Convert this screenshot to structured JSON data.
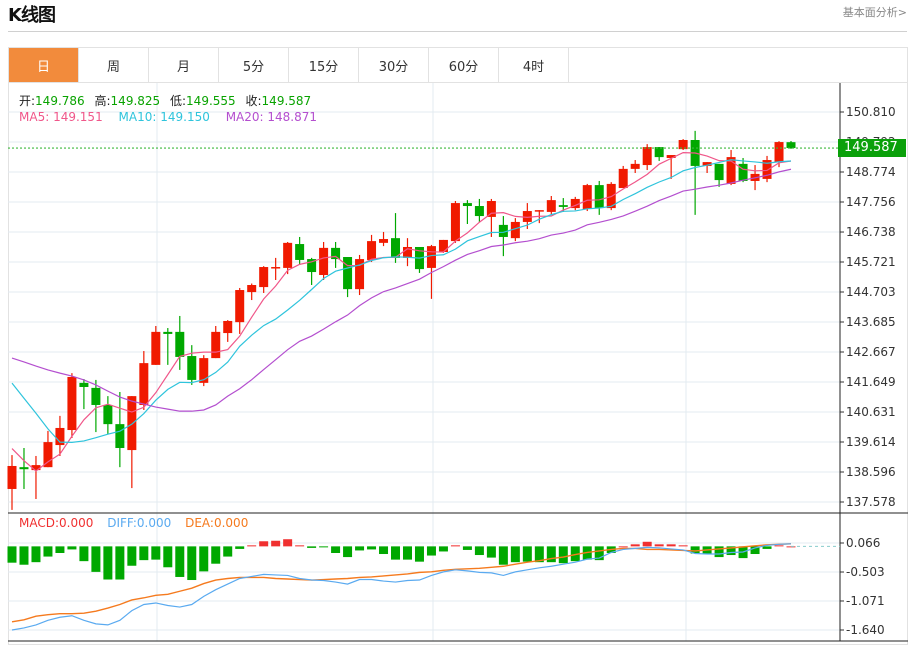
{
  "header": {
    "title": "K线图",
    "fundamental_link": "基本面分析>"
  },
  "tabs": [
    {
      "label": "日",
      "active": true
    },
    {
      "label": "周",
      "active": false
    },
    {
      "label": "月",
      "active": false
    },
    {
      "label": "5分",
      "active": false
    },
    {
      "label": "15分",
      "active": false
    },
    {
      "label": "30分",
      "active": false
    },
    {
      "label": "60分",
      "active": false
    },
    {
      "label": "4时",
      "active": false
    }
  ],
  "ohlc": {
    "open_label": "开:",
    "open": "149.786",
    "high_label": "高:",
    "high": "149.825",
    "low_label": "低:",
    "low": "149.555",
    "close_label": "收:",
    "close": "149.587"
  },
  "ma_legend": {
    "ma5_label": "MA5:",
    "ma5": "149.151",
    "ma10_label": "MA10:",
    "ma10": "149.150",
    "ma20_label": "MA20:",
    "ma20": "148.871"
  },
  "macd_legend": {
    "macd_label": "MACD:",
    "macd": "0.000",
    "diff_label": "DIFF:",
    "diff": "0.000",
    "dea_label": "DEA:",
    "dea": "0.000"
  },
  "last_price_label": "149.587",
  "colors": {
    "up": "#f01a00",
    "down": "#00a800",
    "ma5": "#f0578a",
    "ma10": "#2fc4dc",
    "ma20": "#b44fcf",
    "diff": "#5aaaf0",
    "dea": "#f57a1e",
    "macd": "#f03030",
    "last_price": "#0aa00a",
    "active_tab": "#f28b3c"
  },
  "chart_data": [
    {
      "type": "candlestick",
      "price_ticks": [
        "150.810",
        "149.792",
        "148.774",
        "147.756",
        "146.738",
        "145.721",
        "144.703",
        "143.685",
        "142.667",
        "141.649",
        "140.631",
        "139.614",
        "138.596",
        "137.578"
      ],
      "ylim": [
        137.578,
        150.81
      ],
      "grid": true,
      "last_close": 149.587,
      "candles": [
        [
          138.02,
          139.17,
          137.31,
          138.8
        ],
        [
          138.76,
          139.41,
          138.02,
          138.69
        ],
        [
          138.66,
          139.14,
          137.68,
          138.83
        ],
        [
          138.76,
          139.99,
          138.76,
          139.61
        ],
        [
          139.51,
          140.5,
          139.14,
          140.09
        ],
        [
          140.02,
          141.95,
          139.75,
          141.82
        ],
        [
          141.62,
          141.75,
          140.73,
          141.48
        ],
        [
          141.45,
          141.72,
          139.95,
          140.87
        ],
        [
          140.87,
          141.17,
          139.88,
          140.22
        ],
        [
          140.22,
          141.31,
          138.76,
          139.41
        ],
        [
          139.34,
          141.17,
          138.05,
          141.17
        ],
        [
          140.87,
          142.7,
          140.7,
          142.29
        ],
        [
          142.23,
          143.55,
          142.23,
          143.35
        ],
        [
          143.35,
          143.48,
          142.23,
          143.28
        ],
        [
          143.35,
          143.89,
          142.06,
          142.5
        ],
        [
          142.53,
          142.9,
          141.55,
          141.72
        ],
        [
          141.62,
          142.56,
          141.51,
          142.46
        ],
        [
          142.46,
          143.55,
          142.46,
          143.35
        ],
        [
          143.31,
          143.75,
          143.01,
          143.72
        ],
        [
          143.68,
          144.84,
          143.28,
          144.77
        ],
        [
          144.7,
          144.99,
          144.43,
          144.94
        ],
        [
          144.87,
          145.58,
          144.67,
          145.55
        ],
        [
          145.52,
          145.86,
          145.11,
          145.55
        ],
        [
          145.52,
          146.4,
          145.31,
          146.37
        ],
        [
          146.33,
          146.57,
          145.62,
          145.79
        ],
        [
          145.82,
          145.86,
          144.94,
          145.38
        ],
        [
          145.28,
          146.4,
          145.11,
          146.2
        ],
        [
          146.2,
          146.4,
          145.52,
          145.82
        ],
        [
          145.89,
          145.89,
          144.53,
          144.8
        ],
        [
          144.8,
          145.96,
          144.6,
          145.82
        ],
        [
          145.79,
          146.64,
          145.72,
          146.43
        ],
        [
          146.37,
          146.74,
          146.26,
          146.5
        ],
        [
          146.53,
          147.38,
          145.69,
          145.86
        ],
        [
          145.86,
          146.53,
          145.58,
          146.23
        ],
        [
          146.23,
          146.23,
          145.35,
          145.48
        ],
        [
          145.52,
          146.3,
          144.47,
          146.26
        ],
        [
          146.06,
          146.47,
          146.03,
          146.47
        ],
        [
          146.43,
          147.79,
          146.37,
          147.72
        ],
        [
          147.72,
          147.82,
          147.01,
          147.62
        ],
        [
          147.62,
          147.86,
          147.08,
          147.28
        ],
        [
          147.25,
          147.86,
          146.57,
          147.79
        ],
        [
          146.98,
          147.28,
          145.92,
          146.57
        ],
        [
          146.53,
          147.21,
          146.43,
          147.08
        ],
        [
          147.08,
          147.72,
          146.84,
          147.45
        ],
        [
          147.45,
          147.48,
          147.04,
          147.48
        ],
        [
          147.42,
          147.96,
          147.32,
          147.82
        ],
        [
          147.65,
          147.89,
          147.42,
          147.59
        ],
        [
          147.55,
          147.93,
          147.48,
          147.86
        ],
        [
          147.52,
          148.37,
          147.45,
          148.33
        ],
        [
          148.33,
          148.47,
          147.32,
          147.55
        ],
        [
          147.55,
          148.43,
          147.48,
          148.37
        ],
        [
          148.23,
          148.98,
          148.23,
          148.88
        ],
        [
          148.88,
          149.18,
          148.74,
          149.05
        ],
        [
          149.01,
          149.72,
          148.84,
          149.62
        ],
        [
          149.62,
          149.62,
          149.15,
          149.28
        ],
        [
          149.25,
          149.35,
          148.54,
          149.35
        ],
        [
          149.55,
          149.89,
          149.52,
          149.86
        ],
        [
          149.86,
          150.17,
          147.32,
          148.98
        ],
        [
          148.98,
          149.11,
          148.74,
          149.11
        ],
        [
          149.05,
          149.05,
          148.27,
          148.5
        ],
        [
          148.37,
          149.52,
          148.33,
          149.28
        ],
        [
          149.05,
          149.25,
          148.43,
          148.47
        ],
        [
          148.47,
          149.01,
          148.16,
          148.71
        ],
        [
          148.54,
          149.32,
          148.43,
          149.18
        ],
        [
          149.11,
          149.82,
          148.94,
          149.79
        ],
        [
          149.786,
          149.825,
          149.555,
          149.587
        ]
      ],
      "ma_lead": {
        "ma5": [
          139.39,
          138.98,
          138.63,
          138.94
        ],
        "ma10": [
          141.61,
          141.1,
          140.59,
          140.06,
          139.61,
          139.6,
          139.65,
          139.76,
          139.88
        ],
        "ma20": [
          142.46,
          142.33,
          142.19,
          142.06,
          141.95,
          141.85,
          141.72,
          141.55,
          141.34,
          141.14,
          141.0,
          140.9,
          140.8,
          140.73,
          140.66,
          140.66,
          140.7,
          140.87,
          141.17
        ]
      }
    },
    {
      "type": "macd",
      "ticks": [
        "0.066",
        "-0.503",
        "-1.071",
        "-1.640"
      ],
      "ylim": [
        -1.64,
        0.066
      ],
      "histogram": [
        -0.32,
        -0.36,
        -0.31,
        -0.2,
        -0.13,
        -0.06,
        -0.29,
        -0.5,
        -0.65,
        -0.65,
        -0.38,
        -0.27,
        -0.26,
        -0.41,
        -0.6,
        -0.66,
        -0.49,
        -0.34,
        -0.2,
        -0.05,
        0.02,
        0.1,
        0.11,
        0.14,
        0.02,
        -0.03,
        -0.01,
        -0.13,
        -0.21,
        -0.08,
        -0.06,
        -0.15,
        -0.26,
        -0.26,
        -0.3,
        -0.18,
        -0.1,
        0.02,
        -0.07,
        -0.17,
        -0.22,
        -0.36,
        -0.31,
        -0.3,
        -0.31,
        -0.31,
        -0.33,
        -0.29,
        -0.26,
        -0.27,
        -0.13,
        0.0,
        0.04,
        0.09,
        0.04,
        0.04,
        0.02,
        -0.14,
        -0.15,
        -0.21,
        -0.17,
        -0.23,
        -0.15,
        -0.05,
        0.02,
        0.0
      ],
      "diff": [
        -1.64,
        -1.6,
        -1.54,
        -1.45,
        -1.39,
        -1.36,
        -1.45,
        -1.52,
        -1.54,
        -1.45,
        -1.26,
        -1.14,
        -1.11,
        -1.16,
        -1.19,
        -1.14,
        -0.98,
        -0.85,
        -0.74,
        -0.63,
        -0.59,
        -0.55,
        -0.56,
        -0.57,
        -0.63,
        -0.66,
        -0.67,
        -0.7,
        -0.74,
        -0.65,
        -0.65,
        -0.68,
        -0.7,
        -0.67,
        -0.66,
        -0.57,
        -0.5,
        -0.46,
        -0.48,
        -0.51,
        -0.52,
        -0.57,
        -0.5,
        -0.46,
        -0.42,
        -0.39,
        -0.35,
        -0.31,
        -0.25,
        -0.23,
        -0.12,
        -0.06,
        -0.04,
        -0.02,
        -0.03,
        -0.05,
        -0.07,
        -0.14,
        -0.15,
        -0.15,
        -0.12,
        -0.11,
        -0.03,
        0.02,
        0.04,
        0.05
      ],
      "dea": [
        -1.48,
        -1.44,
        -1.37,
        -1.34,
        -1.32,
        -1.32,
        -1.31,
        -1.27,
        -1.21,
        -1.14,
        -1.05,
        -1.01,
        -0.96,
        -0.94,
        -0.88,
        -0.82,
        -0.73,
        -0.66,
        -0.63,
        -0.61,
        -0.61,
        -0.61,
        -0.63,
        -0.64,
        -0.65,
        -0.66,
        -0.65,
        -0.64,
        -0.63,
        -0.61,
        -0.6,
        -0.58,
        -0.56,
        -0.54,
        -0.51,
        -0.5,
        -0.47,
        -0.45,
        -0.44,
        -0.43,
        -0.41,
        -0.39,
        -0.35,
        -0.31,
        -0.28,
        -0.24,
        -0.21,
        -0.16,
        -0.12,
        -0.09,
        -0.06,
        -0.04,
        -0.04,
        -0.06,
        -0.06,
        -0.07,
        -0.08,
        -0.09,
        -0.07,
        -0.05,
        -0.03,
        -0.01,
        0.01,
        0.03,
        0.04,
        0.05
      ]
    }
  ]
}
